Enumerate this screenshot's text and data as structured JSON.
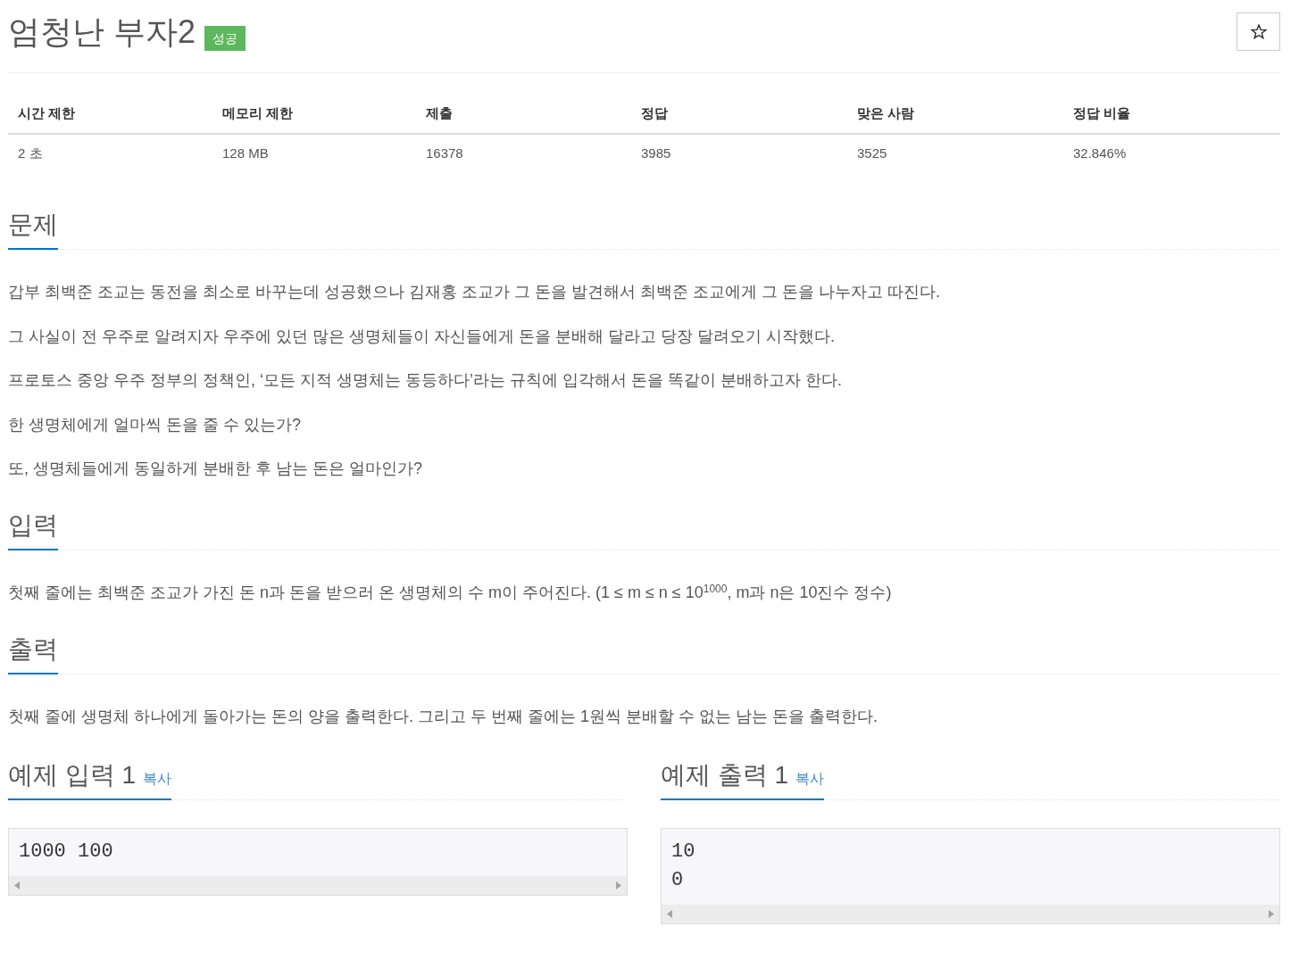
{
  "title": "엄청난 부자2",
  "result_badge": "성공",
  "stats_table": {
    "columns": [
      "시간 제한",
      "메모리 제한",
      "제출",
      "정답",
      "맞은 사람",
      "정답 비율"
    ],
    "rows": [
      [
        "2 초",
        "128 MB",
        "16378",
        "3985",
        "3525",
        "32.846%"
      ]
    ]
  },
  "sections": [
    {
      "heading": "문제",
      "paragraphs": [
        "갑부 최백준 조교는 동전을 최소로 바꾸는데 성공했으나 김재홍 조교가 그 돈을 발견해서 최백준 조교에게 그 돈을 나누자고 따진다.",
        "그 사실이 전 우주로 알려지자 우주에 있던 많은 생명체들이 자신들에게 돈을 분배해 달라고 당장 달려오기 시작했다.",
        "프로토스 중앙 우주 정부의 정책인, ‘모든 지적 생명체는 동등하다’라는 규칙에 입각해서 돈을 똑같이 분배하고자 한다.",
        "한 생명체에게 얼마씩 돈을 줄 수 있는가?",
        "또, 생명체들에게 동일하게 분배한 후 남는 돈은 얼마인가?"
      ]
    },
    {
      "heading": "입력",
      "paragraphs": [
        "첫째 줄에는 최백준 조교가 가진 돈 n과 돈을 받으러 온 생명체의 수 m이 주어진다. (1 ≤ m ≤ n ≤ 10$^{1000}$, m과 n은 10진수 정수)"
      ]
    },
    {
      "heading": "출력",
      "paragraphs": [
        "첫째 줄에 생명체 하나에게 돌아가는 돈의 양을 출력한다. 그리고 두 번째 줄에는 1원씩 분배할 수 없는 남는 돈을 출력한다."
      ]
    }
  ],
  "samples": [
    {
      "heading": "예제 입력 1",
      "copy_link": "복사",
      "lines": [
        "1000 100"
      ]
    },
    {
      "heading": "예제 출력 1",
      "copy_link": "복사",
      "lines": [
        "10",
        "0"
      ]
    }
  ]
}
